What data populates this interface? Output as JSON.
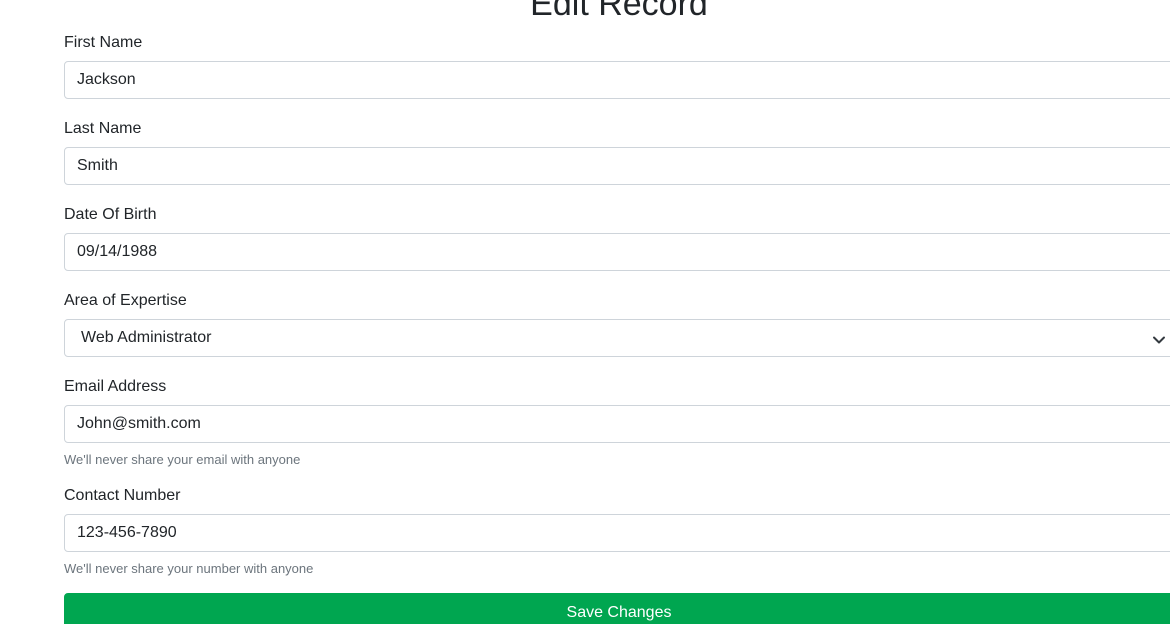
{
  "page": {
    "title": "Edit Record"
  },
  "form": {
    "first_name": {
      "label": "First Name",
      "value": "Jackson"
    },
    "last_name": {
      "label": "Last Name",
      "value": "Smith"
    },
    "date_of_birth": {
      "label": "Date Of Birth",
      "value": "09/14/1988"
    },
    "area_of_expertise": {
      "label": "Area of Expertise",
      "selected": "Web Administrator"
    },
    "email": {
      "label": "Email Address",
      "value": "John@smith.com",
      "help": "We'll never share your email with anyone"
    },
    "contact_number": {
      "label": "Contact Number",
      "value": "123-456-7890",
      "help": "We'll never share your number with anyone"
    },
    "save_label": "Save Changes"
  },
  "colors": {
    "primary_button": "#00a650",
    "border": "#ced4da",
    "help_text": "#6c757d"
  }
}
